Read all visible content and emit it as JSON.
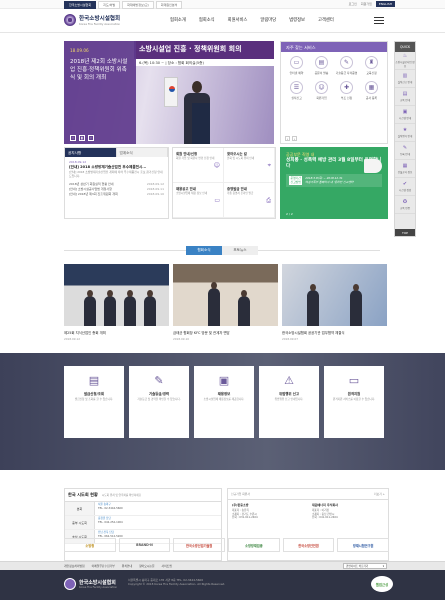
{
  "util": {
    "tabs": [
      "한국소방시설협회",
      "지도/처벌",
      "화재예방정보(교)",
      "화재원인분석"
    ],
    "right_links": [
      "로그인",
      "회원가입",
      "사이트맵"
    ],
    "lang": "ENGLISH"
  },
  "header": {
    "logo_title": "한국소방시설협회",
    "logo_sub": "Korea Fire Facility Association",
    "gnb": [
      "협회소개",
      "협회소식",
      "회원서비스",
      "알림마당",
      "법령정보",
      "고객센터"
    ]
  },
  "visual": {
    "banner": "소방시설업 진흥 · 정책위원회 회의",
    "banner_sub": "6.(목) 10:30 ~ | 장소 : 협회 회의실(5층)",
    "date": "18.09.06",
    "title": "2018년 제2회 소방시설업 진흥·정책위원회 위촉식 및 회의 개최"
  },
  "quick": {
    "title": "자주 찾는 서비스",
    "items": [
      "인터넷 예약",
      "공문서 발송",
      "기술등급 자격증명",
      "교육신청",
      "실적신고",
      "회원가입",
      "부조 신청",
      "공사 등록"
    ]
  },
  "side": {
    "title": "QUICK",
    "items": [
      "소방시설공사업 정보",
      "실적신고 안내",
      "교육 안내",
      "시스템 안내",
      "실적평가 안내",
      "등록 안내",
      "건설공사 정보",
      "시스템 점검",
      "교육 인증"
    ],
    "top": "TOP"
  },
  "notice": {
    "tabs": [
      "공지사항",
      "업계소식"
    ],
    "date": "2018.09.12",
    "lead": "[안내] 2018 소방방재기술산업전 우수제품전시...",
    "summary": "[안내] 2018 소방방재기술산업전 개최에 따라 우수제품전시 홍보 참가신청 안내 드립니다.",
    "items": [
      {
        "t": "2018년 상반기 회원실적 현황 안내",
        "d": "2018.09.12"
      },
      {
        "t": "[안내] 소방시설공사업법 개정사항",
        "d": "2018.09.11"
      },
      {
        "t": "[안내] 2018년 제3회 진흥위원회 개최",
        "d": "2018.09.10"
      }
    ]
  },
  "widgets": [
    {
      "t": "회원 안내/신청",
      "p": "회원 가입 및 회원사 변경 신청 안내"
    },
    {
      "t": "찾아오시는 길",
      "p": "본회 및 시도회 위치 안내"
    },
    {
      "t": "채용공고 안내",
      "p": "소방시설업체 채용 정보 안내"
    },
    {
      "t": "증명발급 안내",
      "p": "각종 증명서 온라인 발급"
    }
  ],
  "popup": {
    "pre": "공공부문 직영 내",
    "title": "성희롱 · 성폭력 예방 관리 3월 8일부터 운영합니다",
    "rows": [
      {
        "k": "운영기간",
        "v": "2018.3.8(목) ~ 2018.12.31"
      },
      {
        "k": "신고방법",
        "v": "여성가족부 홈페이지 내 '온라인 신고센터'"
      }
    ],
    "page": "2 / 2"
  },
  "news": {
    "tabs": [
      "협회소식",
      "포토뉴스"
    ],
    "cards": [
      {
        "t": "제25회 지식산업인 총회 개최",
        "d": "2018.09.12"
      },
      {
        "t": "금태균 협회장 KFC 방문 및 관계자 면담",
        "d": "2018.09.10"
      },
      {
        "t": "한국소방시설협회 공공기관 업무협약 체결식",
        "d": "2018.09.07"
      }
    ]
  },
  "services": [
    {
      "t": "발급신청/조회",
      "d": "발급신청 및 조회를 할 수 있습니다."
    },
    {
      "t": "기술등급/경력",
      "d": "기술등급 및 경력을 확인할 수 있습니다."
    },
    {
      "t": "채용정보",
      "d": "소방시설업체 채용정보를 제공합니다."
    },
    {
      "t": "위법행위 신고",
      "d": "위법행위 신고 안내입니다."
    },
    {
      "t": "원격지원",
      "d": "원격지원 서비스를 이용할 수 있습니다."
    }
  ],
  "consult": {
    "title": "한국 시도회 현황",
    "note": "시도회 위치 및 연락처를 확인하세요",
    "rows": [
      {
        "k": "본회",
        "v1": "서울 송파구",
        "v2": "TEL. 02-3444-5600"
      },
      {
        "k": "중부 시도회",
        "v1": "충청권 담당",
        "v2": "TEL. 042-252-1004"
      },
      {
        "k": "호남 시도회",
        "v1": "전남·전북 담당",
        "v2": "TEL. 062-512-5200"
      }
    ]
  },
  "members": {
    "title": "신규가입 회원사",
    "more": "더보기 +",
    "cols": [
      {
        "t": "(주)한중소방",
        "p": [
          "대표자 : 송유복",
          "소재지 : 경기도 수원시",
          "전화 : 031-911-2404"
        ]
      },
      {
        "t": "대원에너지 주식회사",
        "p": [
          "대표자 : 이기정",
          "소재지 : 충남 천안시",
          "전화 : 041-911-2404"
        ]
      }
    ]
  },
  "logos": [
    "소방청",
    "BRAND-N",
    "한국소방산업기술원",
    "소방방재업종",
    "한국소방안전원",
    "방재시험연구원"
  ],
  "footer_nav": [
    "개인정보처리방침",
    "이메일무단수집거부",
    "위치안내",
    "찾아오시는길",
    "사이트맵"
  ],
  "family_site": "관련사이트 바로가기",
  "footer": {
    "logo": "한국소방시설협회",
    "sub": "Korea Fire Facility Association",
    "addr": "서울특별시 송파구 중대로 135 서관 8층 TEL. 02-3444-5600",
    "copy": "Copyright © 2018 Korea Fire Facility Association. All Rights Reserved.",
    "badge": "웹접근성"
  }
}
